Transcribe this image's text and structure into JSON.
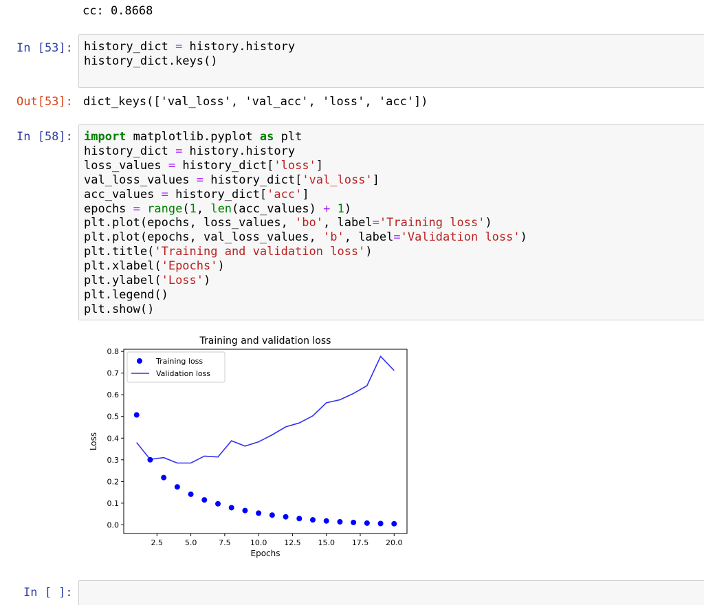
{
  "clipped_output": {
    "text": "cc: 0.8668"
  },
  "cells": [
    {
      "prompt": "In [53]:",
      "lines": [
        [
          [
            "t",
            "history_dict "
          ],
          [
            "op",
            "="
          ],
          [
            "t",
            " history.history"
          ]
        ],
        [
          [
            "t",
            "history_dict.keys()"
          ]
        ]
      ]
    },
    {
      "prompt": "Out[53]:",
      "text": "dict_keys(['val_loss', 'val_acc', 'loss', 'acc'])"
    },
    {
      "prompt": "In [58]:",
      "lines": [
        [
          [
            "kw",
            "import"
          ],
          [
            "t",
            " matplotlib.pyplot "
          ],
          [
            "kw",
            "as"
          ],
          [
            "t",
            " plt"
          ]
        ],
        [
          [
            "t",
            "history_dict "
          ],
          [
            "op",
            "="
          ],
          [
            "t",
            " history.history"
          ]
        ],
        [
          [
            "t",
            "loss_values "
          ],
          [
            "op",
            "="
          ],
          [
            "t",
            " history_dict["
          ],
          [
            "str",
            "'loss'"
          ],
          [
            "t",
            "]"
          ]
        ],
        [
          [
            "t",
            "val_loss_values "
          ],
          [
            "op",
            "="
          ],
          [
            "t",
            " history_dict["
          ],
          [
            "str",
            "'val_loss'"
          ],
          [
            "t",
            "]"
          ]
        ],
        [
          [
            "t",
            "acc_values "
          ],
          [
            "op",
            "="
          ],
          [
            "t",
            " history_dict["
          ],
          [
            "str",
            "'acc'"
          ],
          [
            "t",
            "]"
          ]
        ],
        [
          [
            "t",
            "epochs "
          ],
          [
            "op",
            "="
          ],
          [
            "t",
            " "
          ],
          [
            "bi",
            "range"
          ],
          [
            "t",
            "("
          ],
          [
            "num",
            "1"
          ],
          [
            "t",
            ", "
          ],
          [
            "bi",
            "len"
          ],
          [
            "t",
            "(acc_values) "
          ],
          [
            "op",
            "+"
          ],
          [
            "t",
            " "
          ],
          [
            "num",
            "1"
          ],
          [
            "t",
            ")"
          ]
        ],
        [
          [
            "t",
            "plt.plot(epochs, loss_values, "
          ],
          [
            "str",
            "'bo'"
          ],
          [
            "t",
            ", label"
          ],
          [
            "op",
            "="
          ],
          [
            "str",
            "'Training loss'"
          ],
          [
            "t",
            ")"
          ]
        ],
        [
          [
            "t",
            "plt.plot(epochs, val_loss_values, "
          ],
          [
            "str",
            "'b'"
          ],
          [
            "t",
            ", label"
          ],
          [
            "op",
            "="
          ],
          [
            "str",
            "'Validation loss'"
          ],
          [
            "t",
            ")"
          ]
        ],
        [
          [
            "t",
            "plt.title("
          ],
          [
            "str",
            "'Training and validation loss'"
          ],
          [
            "t",
            ")"
          ]
        ],
        [
          [
            "t",
            "plt.xlabel("
          ],
          [
            "str",
            "'Epochs'"
          ],
          [
            "t",
            ")"
          ]
        ],
        [
          [
            "t",
            "plt.ylabel("
          ],
          [
            "str",
            "'Loss'"
          ],
          [
            "t",
            ")"
          ]
        ],
        [
          [
            "t",
            "plt.legend()"
          ]
        ],
        [
          [
            "t",
            "plt.show()"
          ]
        ]
      ]
    },
    {
      "prompt": "In [ ]:",
      "lines": []
    }
  ],
  "colors": {
    "prompt_in": "#303f9f",
    "prompt_out": "#d84315",
    "series": "#0000ff",
    "line_series": "#3333ee"
  },
  "chart_data": {
    "type": "line",
    "title": "Training and validation loss",
    "xlabel": "Epochs",
    "ylabel": "Loss",
    "xlim": [
      0.05,
      20.95
    ],
    "ylim": [
      -0.04,
      0.81
    ],
    "x_ticks": [
      2.5,
      5.0,
      7.5,
      10.0,
      12.5,
      15.0,
      17.5,
      20.0
    ],
    "x_tick_labels": [
      "2.5",
      "5.0",
      "7.5",
      "10.0",
      "12.5",
      "15.0",
      "17.5",
      "20.0"
    ],
    "y_ticks": [
      0.0,
      0.1,
      0.2,
      0.3,
      0.4,
      0.5,
      0.6,
      0.7,
      0.8
    ],
    "y_tick_labels": [
      "0.0",
      "0.1",
      "0.2",
      "0.3",
      "0.4",
      "0.5",
      "0.6",
      "0.7",
      "0.8"
    ],
    "legend_position": "top-left",
    "grid": false,
    "x": [
      1,
      2,
      3,
      4,
      5,
      6,
      7,
      8,
      9,
      10,
      11,
      12,
      13,
      14,
      15,
      16,
      17,
      18,
      19,
      20
    ],
    "series": [
      {
        "name": "Training loss",
        "style": "points",
        "values": [
          0.507,
          0.3,
          0.218,
          0.175,
          0.141,
          0.115,
          0.097,
          0.079,
          0.066,
          0.054,
          0.045,
          0.037,
          0.029,
          0.023,
          0.018,
          0.014,
          0.011,
          0.008,
          0.006,
          0.005
        ]
      },
      {
        "name": "Validation loss",
        "style": "line",
        "values": [
          0.38,
          0.302,
          0.31,
          0.285,
          0.285,
          0.317,
          0.313,
          0.388,
          0.363,
          0.383,
          0.415,
          0.452,
          0.47,
          0.503,
          0.563,
          0.577,
          0.606,
          0.642,
          0.777,
          0.712
        ]
      }
    ]
  }
}
